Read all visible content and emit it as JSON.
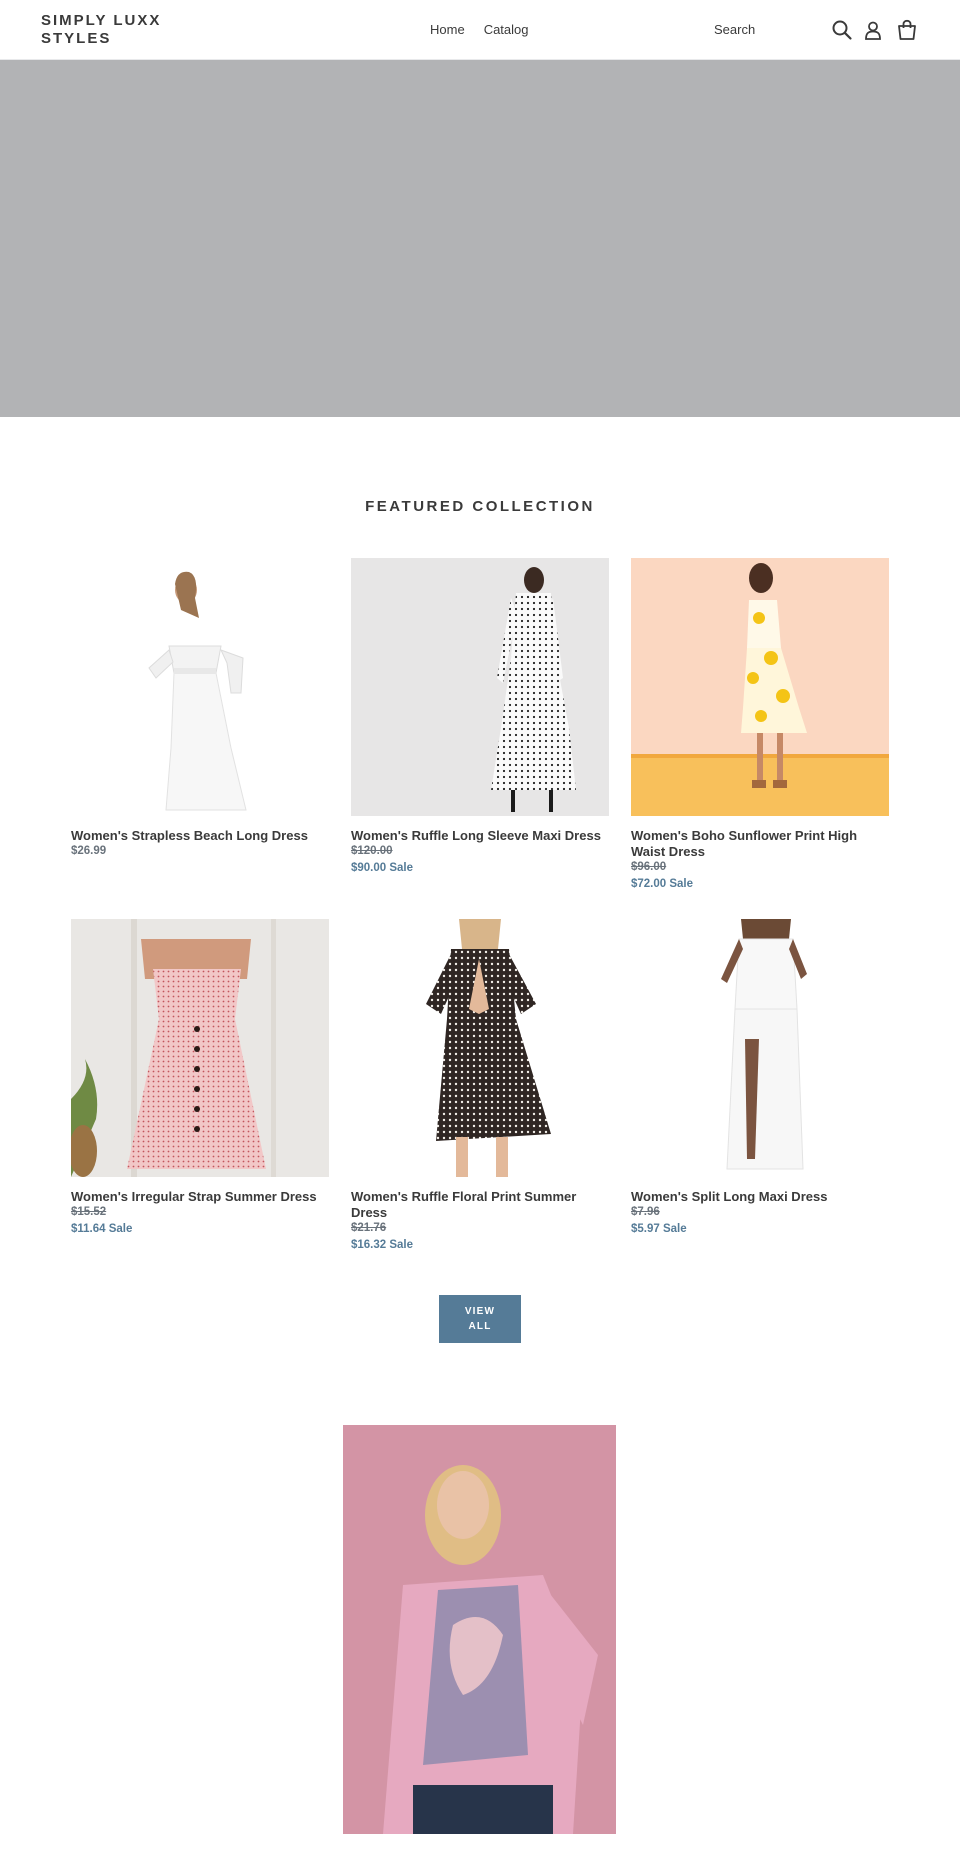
{
  "header": {
    "logo": "SIMPLY LUXX STYLES",
    "nav": [
      "Home",
      "Catalog"
    ],
    "search_placeholder": "Search",
    "icons": [
      "search-icon",
      "account-icon",
      "cart-icon"
    ]
  },
  "featured": {
    "title": "FEATURED COLLECTION",
    "products": [
      {
        "title": "Women's Strapless Beach Long Dress",
        "price": "$26.99"
      },
      {
        "title": "Women's Ruffle Long Sleeve Maxi Dress",
        "original": "$120.00",
        "sale": "$90.00 Sale"
      },
      {
        "title": "Women's Boho Sunflower Print High Waist Dress",
        "original": "$96.00",
        "sale": "$72.00 Sale"
      },
      {
        "title": "Women's Irregular Strap Summer Dress",
        "original": "$15.52",
        "sale": "$11.64 Sale"
      },
      {
        "title": "Women's Ruffle Floral Print Summer Dress",
        "original": "$21.76",
        "sale": "$16.32 Sale"
      },
      {
        "title": "Women's Split Long Maxi Dress",
        "original": "$7.96",
        "sale": "$5.97 Sale"
      }
    ],
    "view_all": "VIEW ALL"
  },
  "colors": {
    "accent": "#557b97",
    "hero": "#b2b3b5",
    "text": "#3a3a3a"
  }
}
